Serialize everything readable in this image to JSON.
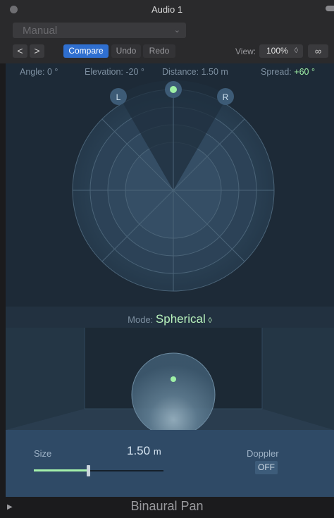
{
  "window": {
    "title": "Audio 1"
  },
  "preset": {
    "value": "Manual"
  },
  "toolbar": {
    "prev": "<",
    "next": ">",
    "compare": "Compare",
    "undo": "Undo",
    "redo": "Redo",
    "view_label": "View:",
    "view_value": "100%",
    "view_chevron": "◊",
    "link_icon": "∞"
  },
  "readouts": {
    "angle_label": "Angle:",
    "angle_value": "0 °",
    "elevation_label": "Elevation:",
    "elevation_value": "-20 °",
    "distance_label": "Distance:",
    "distance_value": "1.50 m",
    "spread_label": "Spread:",
    "spread_value": "+60 °"
  },
  "panner": {
    "left_label": "L",
    "right_label": "R",
    "accent": "#9ef0a6"
  },
  "mode": {
    "label": "Mode:",
    "value": "Spherical",
    "chevron": "◊"
  },
  "size": {
    "label": "Size",
    "value": "1.50",
    "unit": "m",
    "slider_fraction": 0.42
  },
  "doppler": {
    "label": "Doppler",
    "state": "OFF"
  },
  "footer": {
    "plugin_name": "Binaural Pan"
  }
}
